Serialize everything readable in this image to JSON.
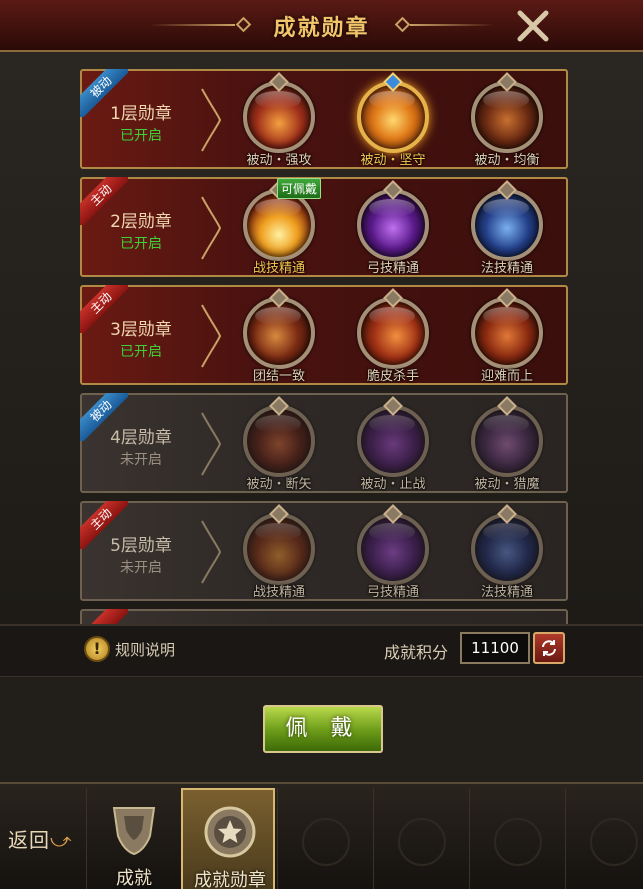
{
  "header": {
    "title": "成就勋章"
  },
  "tiers": [
    {
      "name": "1层勋章",
      "status": "已开启",
      "ribbon": "被动",
      "skills": [
        {
          "label": "被动・强攻"
        },
        {
          "label": "被动・坚守"
        },
        {
          "label": "被动・均衡"
        }
      ]
    },
    {
      "name": "2层勋章",
      "status": "已开启",
      "ribbon": "主动",
      "skills": [
        {
          "label": "战技精通"
        },
        {
          "label": "弓技精通"
        },
        {
          "label": "法技精通"
        }
      ]
    },
    {
      "name": "3层勋章",
      "status": "已开启",
      "ribbon": "主动",
      "skills": [
        {
          "label": "团结一致"
        },
        {
          "label": "脆皮杀手"
        },
        {
          "label": "迎难而上"
        }
      ]
    },
    {
      "name": "4层勋章",
      "status": "未开启",
      "ribbon": "被动",
      "skills": [
        {
          "label": "被动・断矢"
        },
        {
          "label": "被动・止战"
        },
        {
          "label": "被动・猎魔"
        }
      ]
    },
    {
      "name": "5层勋章",
      "status": "未开启",
      "ribbon": "主动",
      "skills": [
        {
          "label": "战技精通"
        },
        {
          "label": "弓技精通"
        },
        {
          "label": "法技精通"
        }
      ]
    }
  ],
  "wearable_badge": "可佩戴",
  "rules_label": "规则说明",
  "score": {
    "label": "成就积分",
    "value": "11100"
  },
  "wear_button": "佩 戴",
  "nav": {
    "back": "返回",
    "tabs": [
      {
        "label": "成就"
      },
      {
        "label": "成就勋章"
      }
    ]
  },
  "colors": {
    "accent_gold": "#f2c56a",
    "open_green": "#3ed13a",
    "passive_ribbon": "#1a5a98",
    "active_ribbon": "#8a1410"
  }
}
